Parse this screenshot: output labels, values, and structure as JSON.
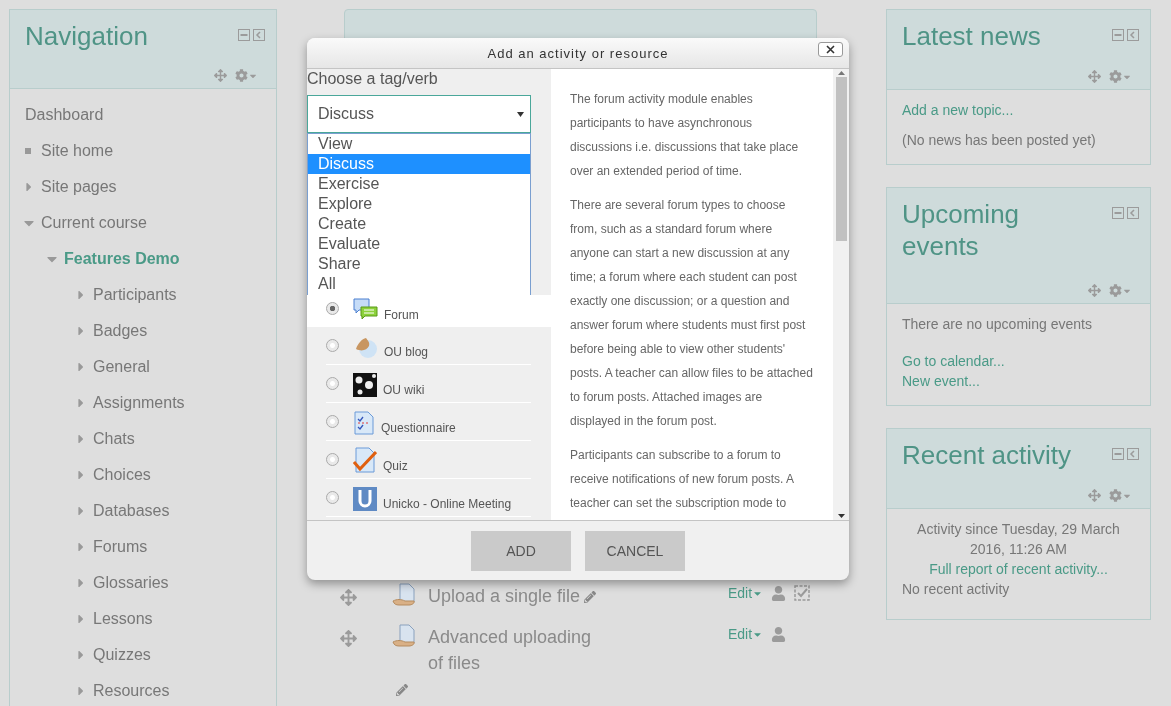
{
  "navigation": {
    "title": "Navigation",
    "items": [
      {
        "label": "Dashboard",
        "kind": "plain"
      },
      {
        "label": "Site home",
        "kind": "leaf"
      },
      {
        "label": "Site pages",
        "kind": "branch",
        "expanded": false
      },
      {
        "label": "Current course",
        "kind": "branch",
        "expanded": true,
        "children": [
          {
            "label": "Features Demo",
            "kind": "branch",
            "expanded": true,
            "current": true,
            "children": [
              {
                "label": "Participants",
                "kind": "branch",
                "expanded": false
              },
              {
                "label": "Badges",
                "kind": "branch",
                "expanded": false
              },
              {
                "label": "General",
                "kind": "branch",
                "expanded": false
              },
              {
                "label": "Assignments",
                "kind": "branch",
                "expanded": false
              },
              {
                "label": "Chats",
                "kind": "branch",
                "expanded": false
              },
              {
                "label": "Choices",
                "kind": "branch",
                "expanded": false
              },
              {
                "label": "Databases",
                "kind": "branch",
                "expanded": false
              },
              {
                "label": "Forums",
                "kind": "branch",
                "expanded": false
              },
              {
                "label": "Glossaries",
                "kind": "branch",
                "expanded": false
              },
              {
                "label": "Lessons",
                "kind": "branch",
                "expanded": false
              },
              {
                "label": "Quizzes",
                "kind": "branch",
                "expanded": false
              },
              {
                "label": "Resources",
                "kind": "branch",
                "expanded": false
              }
            ]
          }
        ]
      }
    ]
  },
  "course_items": [
    {
      "title": "Upload a single file",
      "edit": "Edit",
      "completion_box": true
    },
    {
      "title": "Advanced uploading of files",
      "edit": "Edit",
      "completion_box": false
    }
  ],
  "dialog": {
    "title": "Add an activity or resource",
    "filter_label": "Choose a tag/verb",
    "filter_value": "Discuss",
    "filter_options": [
      {
        "label": "View",
        "selected": false
      },
      {
        "label": "Discuss",
        "selected": true
      },
      {
        "label": "Exercise",
        "selected": false
      },
      {
        "label": "Explore",
        "selected": false
      },
      {
        "label": "Create",
        "selected": false
      },
      {
        "label": "Evaluate",
        "selected": false
      },
      {
        "label": "Share",
        "selected": false
      },
      {
        "label": "All",
        "selected": false
      }
    ],
    "modules": [
      {
        "label": "Forum",
        "kind": "forum",
        "selected": true
      },
      {
        "label": "OU blog",
        "kind": "blog",
        "selected": false
      },
      {
        "label": "OU wiki",
        "kind": "wiki",
        "selected": false
      },
      {
        "label": "Questionnaire",
        "kind": "questionnaire",
        "selected": false
      },
      {
        "label": "Quiz",
        "kind": "quiz",
        "selected": false
      },
      {
        "label": "Unicko - Online Meeting",
        "kind": "meeting",
        "selected": false
      }
    ],
    "description": [
      "The forum activity module enables participants to have asynchronous discussions i.e. discussions that take place over an extended period of time.",
      "There are several forum types to choose from, such as a standard forum where anyone can start a new discussion at any time; a forum where each student can post exactly one discussion; or a question and answer forum where students must first post before being able to view other students' posts. A teacher can allow files to be attached to forum posts. Attached images are displayed in the forum post.",
      "Participants can subscribe to a forum to receive notifications of new forum posts. A teacher can set the subscription mode to"
    ],
    "buttons": [
      "ADD",
      "CANCEL"
    ]
  },
  "latest_news": {
    "title": "Latest news",
    "link": "Add a new topic...",
    "text": "(No news has been posted yet)"
  },
  "upcoming_events": {
    "title": "Upcoming events",
    "text": "There are no upcoming events",
    "links": [
      "Go to calendar...",
      "New event..."
    ]
  },
  "recent_activity": {
    "title": "Recent activity",
    "since": "Activity since Tuesday, 29 March 2016, 11:26 AM",
    "link": "Full report of recent activity...",
    "text": "No recent activity"
  }
}
